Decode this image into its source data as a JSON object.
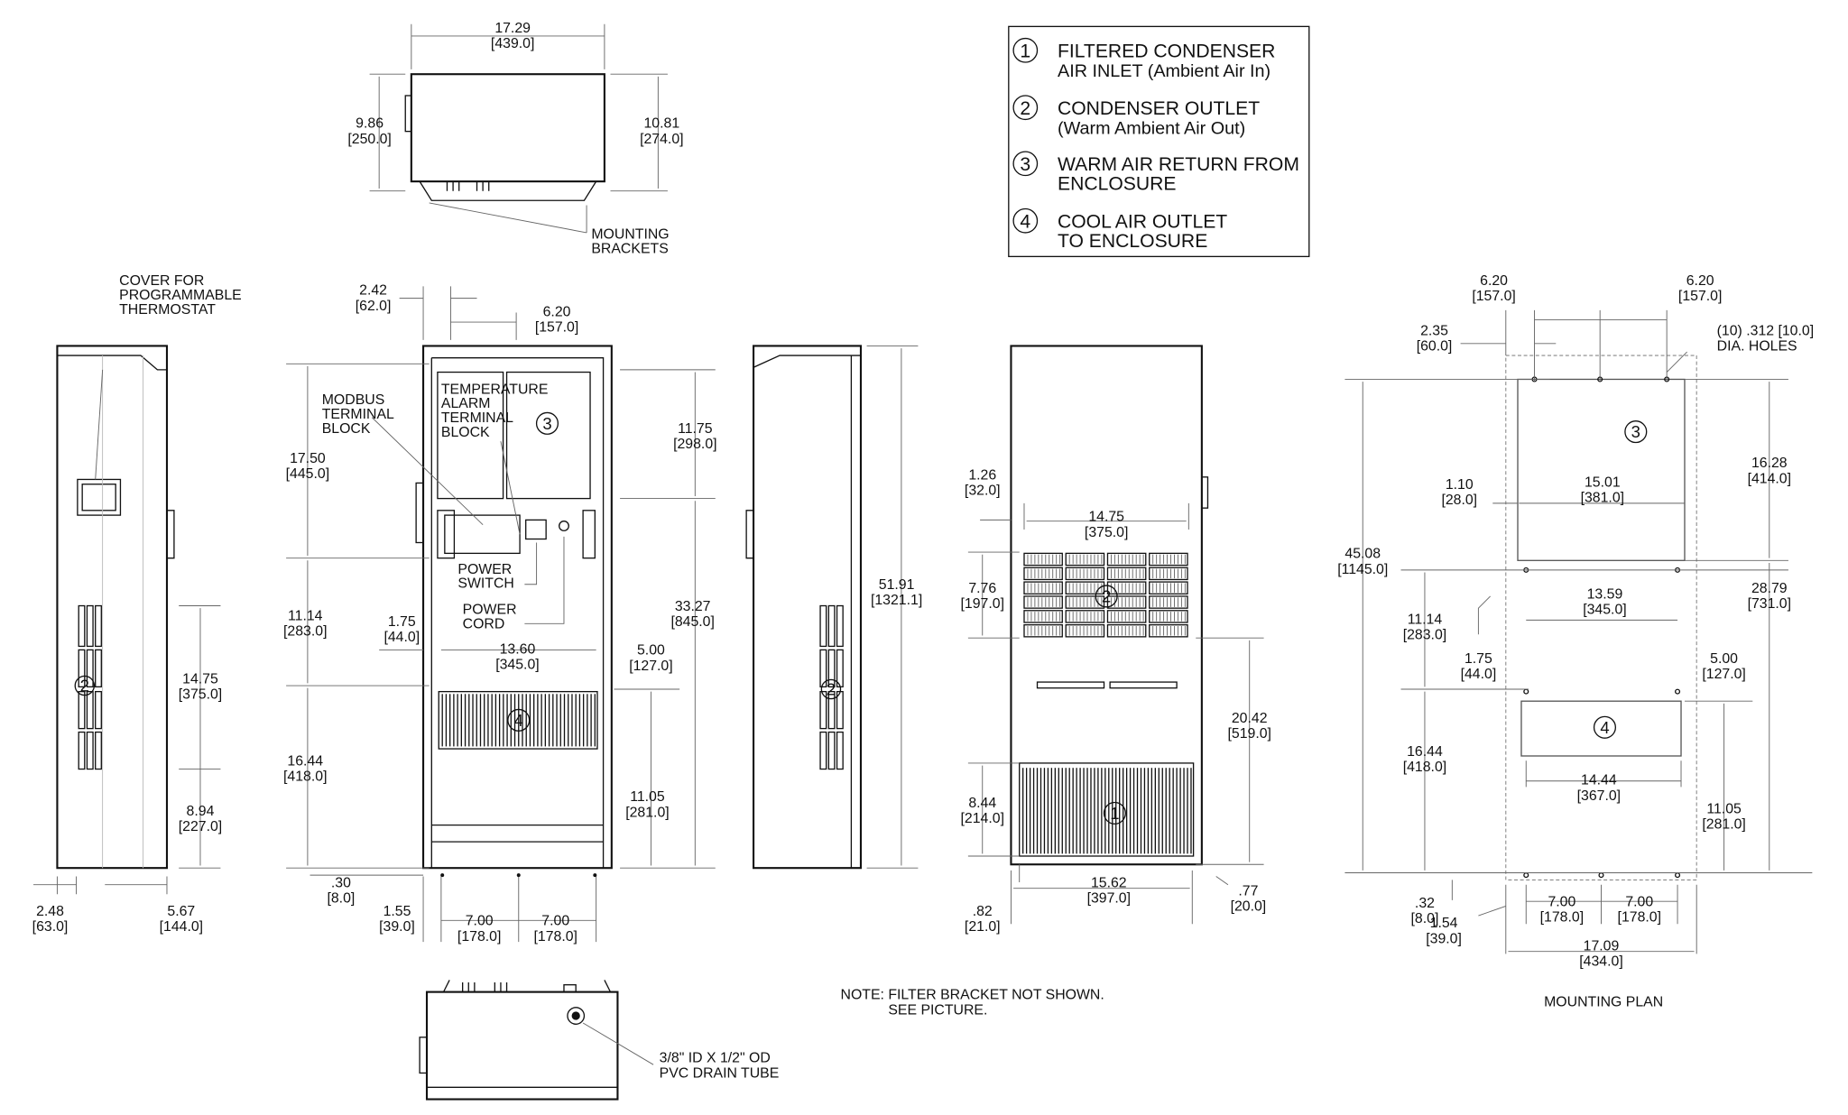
{
  "legend": {
    "items": [
      {
        "num": "1",
        "line1": "FILTERED CONDENSER",
        "line2": "AIR INLET (Ambient Air In)"
      },
      {
        "num": "2",
        "line1": "CONDENSER OUTLET",
        "line2": "(Warm Ambient Air Out)"
      },
      {
        "num": "3",
        "line1": "WARM AIR RETURN FROM",
        "line2": "ENCLOSURE"
      },
      {
        "num": "4",
        "line1": "COOL AIR OUTLET",
        "line2": "TO ENCLOSURE"
      }
    ]
  },
  "labels": {
    "mounting_brackets": [
      "MOUNTING",
      "BRACKETS"
    ],
    "cover_thermostat": [
      "COVER FOR",
      "PROGRAMMABLE",
      "THERMOSTAT"
    ],
    "modbus": [
      "MODBUS",
      "TERMINAL",
      "BLOCK"
    ],
    "temp_alarm": [
      "TEMPERATURE",
      "ALARM",
      "TERMINAL",
      "BLOCK"
    ],
    "power_switch": [
      "POWER",
      "SWITCH"
    ],
    "power_cord": [
      "POWER",
      "CORD"
    ],
    "drain_tube": [
      "3/8\" ID X 1/2\" OD",
      "PVC DRAIN TUBE"
    ],
    "note": [
      "NOTE: FILTER BRACKET NOT SHOWN.",
      "SEE PICTURE."
    ],
    "holes": [
      "(10) .312 [10.0]",
      "DIA. HOLES"
    ],
    "mounting_plan": "MOUNTING PLAN"
  },
  "callouts": {
    "one": "1",
    "two": "2",
    "three": "3",
    "four": "4"
  },
  "dims": {
    "top": [
      {
        "value": "17.29",
        "metric": "[439.0]"
      },
      {
        "value": "9.86",
        "metric": "[250.0]"
      },
      {
        "value": "10.81",
        "metric": "[274.0]"
      }
    ],
    "left": [
      {
        "value": "14.75",
        "metric": "[375.0]"
      },
      {
        "value": "8.94",
        "metric": "[227.0]"
      },
      {
        "value": "2.48",
        "metric": "[63.0]"
      },
      {
        "value": "5.67",
        "metric": "[144.0]"
      }
    ],
    "front": [
      {
        "value": "2.42",
        "metric": "[62.0]"
      },
      {
        "value": "6.20",
        "metric": "[157.0]"
      },
      {
        "value": "17.50",
        "metric": "[445.0]"
      },
      {
        "value": "11.14",
        "metric": "[283.0]"
      },
      {
        "value": "16.44",
        "metric": "[418.0]"
      },
      {
        "value": ".30",
        "metric": "[8.0]"
      },
      {
        "value": "1.55",
        "metric": "[39.0]"
      },
      {
        "value": "7.00",
        "metric": "[178.0]"
      },
      {
        "value": "7.00",
        "metric": "[178.0]"
      },
      {
        "value": "1.75",
        "metric": "[44.0]"
      },
      {
        "value": "13.60",
        "metric": "[345.0]"
      },
      {
        "value": "5.00",
        "metric": "[127.0]"
      },
      {
        "value": "11.75",
        "metric": "[298.0]"
      },
      {
        "value": "33.27",
        "metric": "[845.0]"
      },
      {
        "value": "11.05",
        "metric": "[281.0]"
      }
    ],
    "side": [
      {
        "value": "51.91",
        "metric": "[1321.1]"
      }
    ],
    "rear": [
      {
        "value": "1.26",
        "metric": "[32.0]"
      },
      {
        "value": "14.75",
        "metric": "[375.0]"
      },
      {
        "value": "7.76",
        "metric": "[197.0]"
      },
      {
        "value": "20.42",
        "metric": "[519.0]"
      },
      {
        "value": "8.44",
        "metric": "[214.0]"
      },
      {
        "value": "15.62",
        "metric": "[397.0]"
      },
      {
        "value": ".82",
        "metric": "[21.0]"
      },
      {
        "value": ".77",
        "metric": "[20.0]"
      }
    ],
    "plan": [
      {
        "value": "6.20",
        "metric": "[157.0]"
      },
      {
        "value": "6.20",
        "metric": "[157.0]"
      },
      {
        "value": "2.35",
        "metric": "[60.0]"
      },
      {
        "value": "45.08",
        "metric": "[1145.0]"
      },
      {
        "value": "1.10",
        "metric": "[28.0]"
      },
      {
        "value": "15.01",
        "metric": "[381.0]"
      },
      {
        "value": "16.28",
        "metric": "[414.0]"
      },
      {
        "value": "13.59",
        "metric": "[345.0]"
      },
      {
        "value": "28.79",
        "metric": "[731.0]"
      },
      {
        "value": "11.14",
        "metric": "[283.0]"
      },
      {
        "value": "1.75",
        "metric": "[44.0]"
      },
      {
        "value": "5.00",
        "metric": "[127.0]"
      },
      {
        "value": "16.44",
        "metric": "[418.0]"
      },
      {
        "value": "14.44",
        "metric": "[367.0]"
      },
      {
        "value": "11.05",
        "metric": "[281.0]"
      },
      {
        "value": ".32",
        "metric": "[8.0]"
      },
      {
        "value": "1.54",
        "metric": "[39.0]"
      },
      {
        "value": "7.00",
        "metric": "[178.0]"
      },
      {
        "value": "7.00",
        "metric": "[178.0]"
      },
      {
        "value": "17.09",
        "metric": "[434.0]"
      }
    ]
  }
}
